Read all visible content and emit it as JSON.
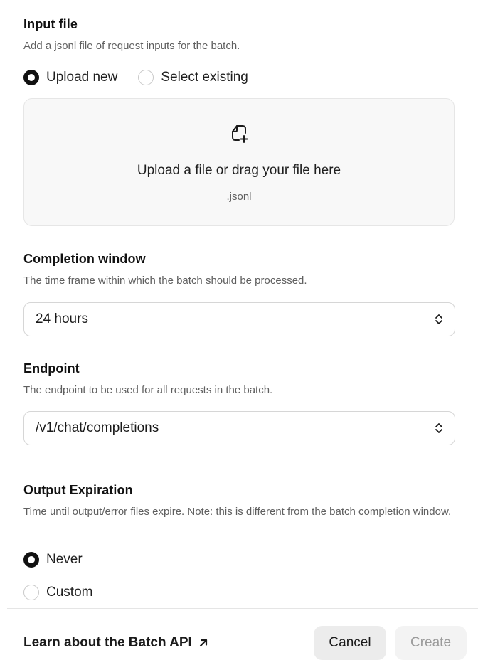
{
  "input_file": {
    "title": "Input file",
    "description": "Add a jsonl file of request inputs for the batch.",
    "options": [
      "Upload new",
      "Select existing"
    ],
    "selected": "Upload new",
    "upload": {
      "icon": "file-plus-icon",
      "text": "Upload a file or drag your file here",
      "accepted": ".jsonl"
    }
  },
  "completion_window": {
    "title": "Completion window",
    "description": "The time frame within which the batch should be processed.",
    "value": "24 hours"
  },
  "endpoint": {
    "title": "Endpoint",
    "description": "The endpoint to be used for all requests in the batch.",
    "value": "/v1/chat/completions"
  },
  "output_expiration": {
    "title": "Output Expiration",
    "description": "Time until output/error files expire. Note: this is different from the batch completion window.",
    "options": [
      "Never",
      "Custom"
    ],
    "selected": "Never"
  },
  "footer": {
    "learn_link": "Learn about the Batch API",
    "learn_icon": "arrow-up-right-icon",
    "cancel_label": "Cancel",
    "create_label": "Create"
  },
  "colors": {
    "selected_radio": "#111111",
    "disabled_button_text": "#9a9a9a",
    "secondary_button_bg": "#ececec"
  }
}
